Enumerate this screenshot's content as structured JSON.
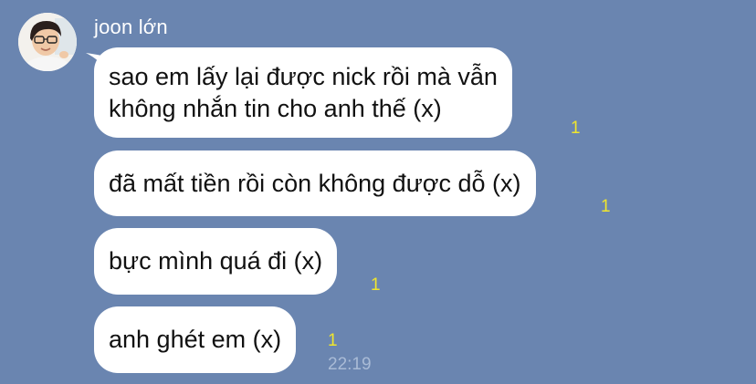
{
  "chat": {
    "sender_name": "joon lớn",
    "avatar_icon": "user-avatar-photo",
    "messages": [
      {
        "lines": [
          "sao em lấy lại được nick rồi mà vẫn",
          "không nhắn tin cho anh thế (x)"
        ],
        "read_count": "1"
      },
      {
        "lines": [
          "đã mất tiền rồi còn không được dỗ (x)"
        ],
        "read_count": "1"
      },
      {
        "lines": [
          "bực mình quá đi (x)"
        ],
        "read_count": "1"
      },
      {
        "lines": [
          "anh ghét em (x)"
        ],
        "read_count": "1"
      }
    ],
    "last_timestamp": "22:19"
  },
  "colors": {
    "background": "#6a85b0",
    "bubble": "#ffffff",
    "read_indicator": "#f0e62c",
    "timestamp": "#a9bbd6"
  }
}
